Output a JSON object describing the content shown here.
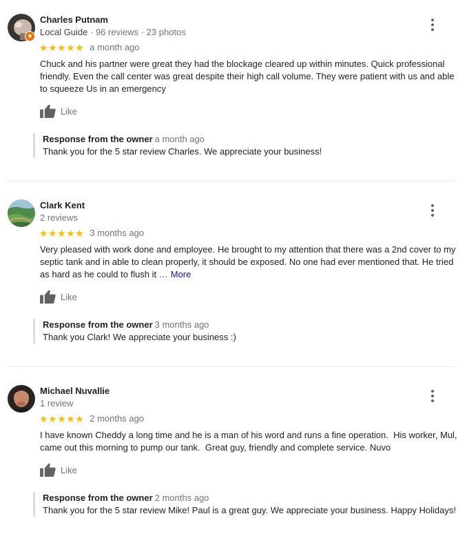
{
  "common": {
    "like_label": "Like",
    "owner_label": "Response from the owner",
    "more_label": "More",
    "star_color": "#fbbc04"
  },
  "reviews": [
    {
      "name": "Charles Putnam",
      "guide_label": "Local Guide",
      "meta": "· 96 reviews · 23 photos",
      "rating": 5,
      "stars": "★★★★★",
      "date": "a month ago",
      "text": "Chuck and his partner were great they had the blockage cleared up within minutes. Quick professional friendly. Even the call center was great despite their high call volume. They were patient with us and able to squeeze Us in an emergency",
      "owner_date": "a month ago",
      "owner_text": "Thank you for the 5 star review Charles. We appreciate your business!"
    },
    {
      "name": "Clark Kent",
      "meta": "2 reviews",
      "rating": 5,
      "stars": "★★★★★",
      "date": "3 months ago",
      "text": "Very pleased with work done and employee. He brought to my attention that there was a 2nd cover to my septic tank and in able to clean properly, it should be exposed. No one had ever mentioned that. He tried as hard as he could to flush it …",
      "owner_date": "3 months ago",
      "owner_text": "Thank you Clark! We appreciate your business :)"
    },
    {
      "name": "Michael Nuvallie",
      "meta": "1 review",
      "rating": 5,
      "stars": "★★★★★",
      "date": "2 months ago",
      "text": "I have known Cheddy a long time and he is a man of his word and runs a fine operation.  His worker, Mul, came out this morning to pump our tank.  Great guy, friendly and complete service. Nuvo",
      "owner_date": "2 months ago",
      "owner_text": "Thank you for the 5 star review Mike! Paul is a great guy. We appreciate your business. Happy Holidays!"
    }
  ]
}
